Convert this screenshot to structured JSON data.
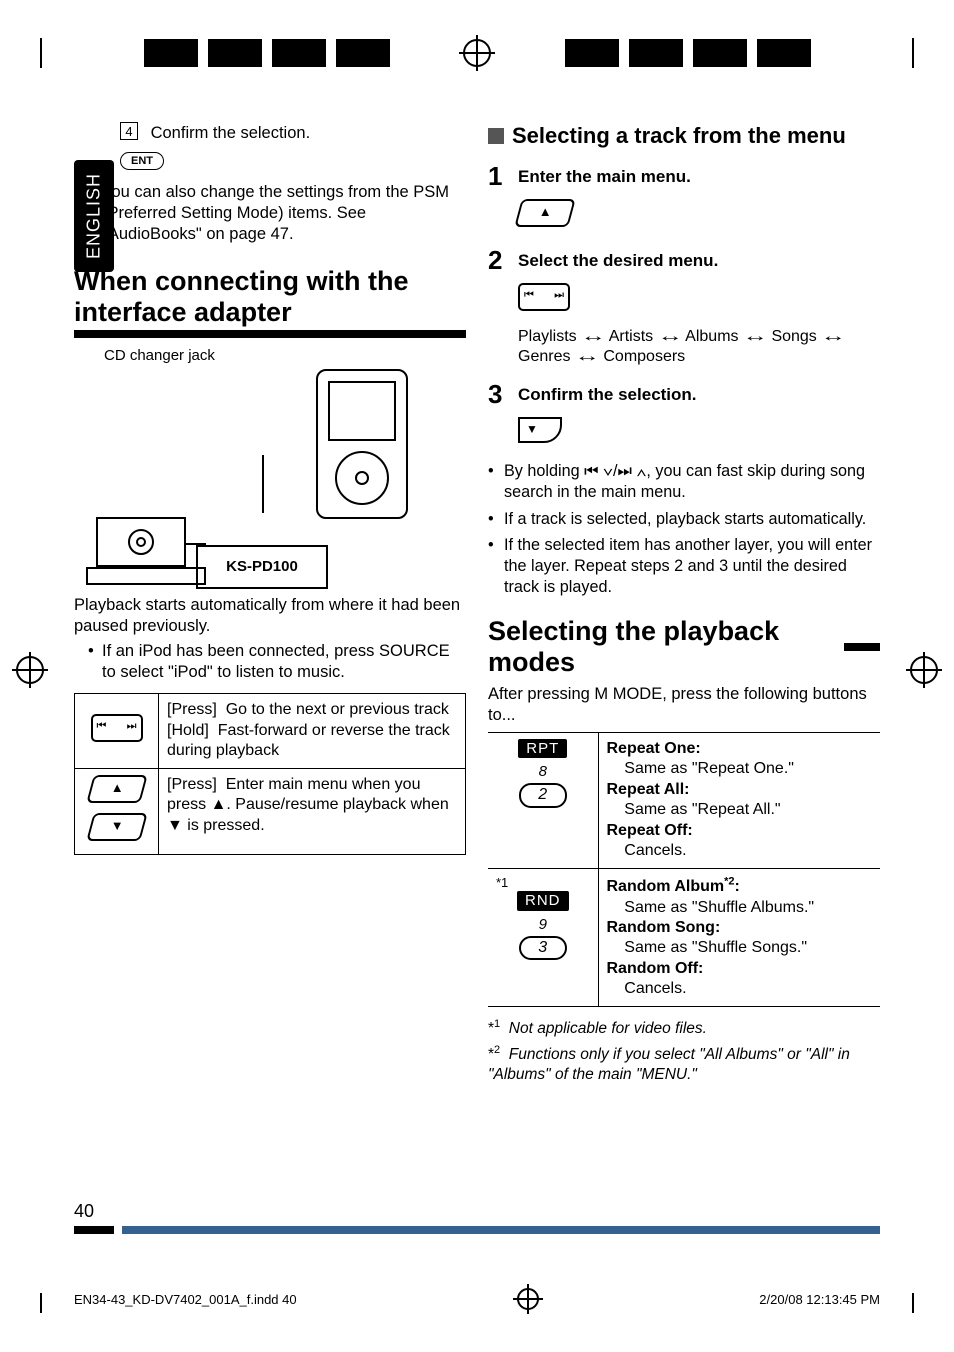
{
  "lang_tab": "ENGLISH",
  "left": {
    "step4_num": "4",
    "step4_text": "Confirm the selection.",
    "ent_label": "ENT",
    "psm_note": "You can also change the settings from the PSM (Preferred Setting Mode) items. See \"AudioBooks\" on page 47.",
    "heading": "When connecting with the interface adapter",
    "diagram_label": "CD changer jack",
    "ks_label": "KS-PD100",
    "playback_text": "Playback starts automatically from where it had been paused previously.",
    "ipod_note": "If an iPod has been connected, press SOURCE to select \"iPod\" to listen to music.",
    "ctrl_rows": [
      {
        "icon": "rocker",
        "actions": [
          {
            "k": "[Press]",
            "v": "Go to the next or previous track"
          },
          {
            "k": "[Hold]",
            "v": "Fast-forward or reverse the track during playback"
          }
        ]
      },
      {
        "icon": "updown",
        "actions": [
          {
            "k": "[Press]",
            "v": "Enter main menu when you press ▲. Pause/resume playback when ▼ is pressed."
          }
        ]
      }
    ]
  },
  "right": {
    "sec1_title": "Selecting a track from the menu",
    "steps": [
      {
        "n": "1",
        "t": "Enter the main menu."
      },
      {
        "n": "2",
        "t": "Select the desired menu."
      },
      {
        "n": "3",
        "t": "Confirm the selection."
      }
    ],
    "menu_items": [
      "Playlists",
      "Artists",
      "Albums",
      "Songs",
      "Genres",
      "Composers"
    ],
    "notes": [
      "By holding ⏮ ∨/⏭ ∧, you can fast skip during song search in the main menu.",
      "If a track is selected, playback starts automatically.",
      "If the selected item has another layer, you will enter the layer. Repeat steps 2 and 3 until the desired track is played."
    ],
    "sec2_title": "Selecting the playback modes",
    "sec2_intro": "After pressing M MODE, press the following buttons to...",
    "modes": [
      {
        "sup": "",
        "lbl": "RPT",
        "dig": "8",
        "numbtn": "2",
        "lines": [
          {
            "b": "Repeat One:",
            "t": "Same as \"Repeat One.\""
          },
          {
            "b": "Repeat All:",
            "t": "Same as \"Repeat All.\""
          },
          {
            "b": "Repeat Off:",
            "t": "Cancels."
          }
        ]
      },
      {
        "sup": "*1",
        "lbl": "RND",
        "dig": "9",
        "numbtn": "3",
        "lines": [
          {
            "b": "Random Album*2:",
            "b_sup": "2",
            "b_pre": "Random Album",
            "t": "Same as \"Shuffle Albums.\""
          },
          {
            "b": "Random Song:",
            "t": "Same as \"Shuffle Songs.\""
          },
          {
            "b": "Random Off:",
            "t": "Cancels."
          }
        ]
      }
    ],
    "footnotes": [
      {
        "k": "*1",
        "t": "Not applicable for video files."
      },
      {
        "k": "*2",
        "t": "Functions only if you select \"All Albums\" or \"All\" in \"Albums\" of the main \"MENU.\""
      }
    ]
  },
  "page_number": "40",
  "printline": {
    "file": "EN34-43_KD-DV7402_001A_f.indd   40",
    "date": "2/20/08   12:13:45 PM"
  }
}
